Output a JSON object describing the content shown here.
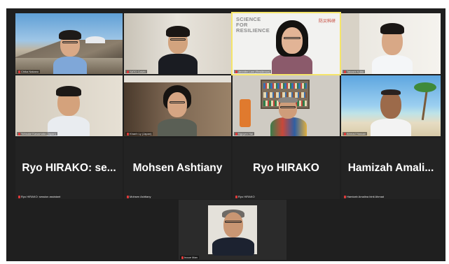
{
  "meeting": {
    "participants": [
      {
        "id": "p1",
        "caption": "Chika Nakano",
        "mic": "on"
      },
      {
        "id": "p2",
        "caption": "SATO Calvin",
        "mic": "on"
      },
      {
        "id": "p3",
        "caption": "Jennifer Lam (Resilience)",
        "mic": "on",
        "background_title": "SCIENCE FOR RESILIENCE",
        "background_logo": "防災科研"
      },
      {
        "id": "p4",
        "caption": "Takashi Kubo",
        "mic": "on"
      },
      {
        "id": "p5",
        "caption": "Yohsuke Kawamata (Japan)",
        "mic": "muted"
      },
      {
        "id": "p6",
        "caption": "Khanh Ly (Japan)",
        "mic": "muted"
      },
      {
        "id": "p7",
        "caption": "Nguyen Hai",
        "mic": "on"
      },
      {
        "id": "p8",
        "caption": "Ahmad Hassan",
        "mic": "muted"
      },
      {
        "id": "p9",
        "display_name": "Ryo HIRAKO: se...",
        "caption": "Ryo HIRAKO: session assistant",
        "mic": "muted"
      },
      {
        "id": "p10",
        "display_name": "Mohsen Ashtiany",
        "caption": "Mohsen Ashtiany",
        "mic": "muted"
      },
      {
        "id": "p11",
        "display_name": "Ryo HIRAKO",
        "caption": "Ryo HIRAKO",
        "mic": "muted"
      },
      {
        "id": "p12",
        "display_name": "Hamizah Amali...",
        "caption": "Hamizah Amalina binti Ahmad",
        "mic": "muted"
      },
      {
        "id": "p13",
        "caption": "Inoue Man",
        "mic": "muted"
      }
    ]
  },
  "colors": {
    "background": "#1f1f1f",
    "tile": "#2a2a2a",
    "muted_mic": "#e03a3a",
    "name_text": "#ffffff"
  }
}
